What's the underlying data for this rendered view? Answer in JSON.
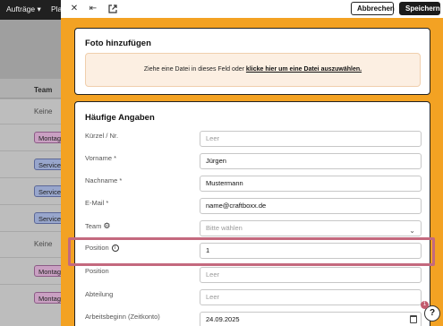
{
  "background": {
    "nav": [
      "Aufträge",
      "Pla"
    ],
    "column_header": "Team",
    "rows": [
      {
        "type": "text",
        "value": "Keine"
      },
      {
        "type": "badge",
        "value": "Montage",
        "color": "#c9a0c2"
      },
      {
        "type": "badge",
        "value": "Service",
        "color": "#98a6cc"
      },
      {
        "type": "badge",
        "value": "Service",
        "color": "#98a6cc"
      },
      {
        "type": "badge",
        "value": "Service",
        "color": "#98a6cc"
      },
      {
        "type": "text",
        "value": "Keine"
      },
      {
        "type": "badge",
        "value": "Montage",
        "color": "#c9a0c2"
      },
      {
        "type": "badge",
        "value": "Montage",
        "color": "#c9a0c2"
      }
    ]
  },
  "toolbar": {
    "close_icon": "close-icon",
    "collapse_icon": "collapse-icon",
    "open_external_icon": "external-link-icon",
    "cancel_label": "Abbrechen",
    "save_label": "Speichern"
  },
  "photo_section": {
    "title": "Foto hinzufügen",
    "dropzone_text": "Ziehe eine Datei in dieses Feld oder ",
    "dropzone_link": "klicke hier um eine Datei auszuwählen."
  },
  "main_section": {
    "title": "Häufige Angaben",
    "fields": [
      {
        "label": "Kürzel / Nr.",
        "value": "",
        "placeholder": "Leer"
      },
      {
        "label": "Vorname *",
        "value": "Jürgen",
        "placeholder": ""
      },
      {
        "label": "Nachname *",
        "value": "Mustermann",
        "placeholder": ""
      },
      {
        "label": "E-Mail *",
        "value": "name@craftboxx.de",
        "placeholder": ""
      },
      {
        "label": "Team",
        "value": "",
        "placeholder": "Bitte wählen"
      },
      {
        "label": "Position",
        "value": "1",
        "placeholder": ""
      },
      {
        "label": "Position",
        "value": "",
        "placeholder": "Leer"
      },
      {
        "label": "Abteilung",
        "value": "",
        "placeholder": "Leer"
      },
      {
        "label": "Arbeitsbeginn (Zeitkonto)",
        "value": "24.09.2025",
        "placeholder": ""
      }
    ]
  },
  "help": {
    "label": "?",
    "badge": "1"
  },
  "colors": {
    "modal_accent": "#f3a223",
    "highlight": "#c4697e",
    "dropzone_bg": "#fcefe2"
  }
}
